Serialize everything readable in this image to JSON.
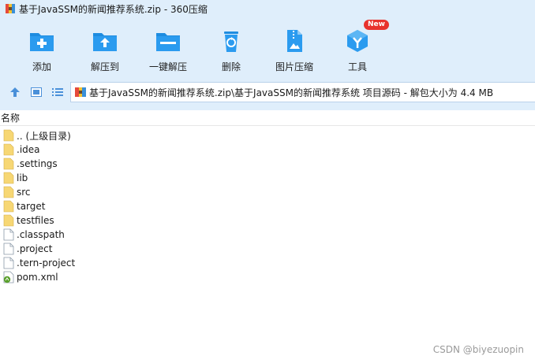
{
  "window": {
    "title": "基于JavaSSM的新闻推荐系统.zip - 360压缩"
  },
  "toolbar": {
    "add_label": "添加",
    "extract_to_label": "解压到",
    "one_click_extract_label": "一键解压",
    "delete_label": "删除",
    "image_compress_label": "图片压缩",
    "tools_label": "工具",
    "tools_badge": "New"
  },
  "address": {
    "path": "基于JavaSSM的新闻推荐系统.zip\\基于JavaSSM的新闻推荐系统 项目源码 - 解包大小为 4.4 MB"
  },
  "list": {
    "column_name": "名称",
    "items": [
      {
        "label": ".. (上级目录)",
        "type": "folder"
      },
      {
        "label": ".idea",
        "type": "folder"
      },
      {
        "label": ".settings",
        "type": "folder"
      },
      {
        "label": "lib",
        "type": "folder"
      },
      {
        "label": "src",
        "type": "folder"
      },
      {
        "label": "target",
        "type": "folder"
      },
      {
        "label": "testfiles",
        "type": "folder"
      },
      {
        "label": ".classpath",
        "type": "file"
      },
      {
        "label": ".project",
        "type": "file"
      },
      {
        "label": ".tern-project",
        "type": "file"
      },
      {
        "label": "pom.xml",
        "type": "xml"
      }
    ]
  },
  "watermark": "CSDN @biyezuopin",
  "colors": {
    "chrome_bg": "#dfeefb",
    "icon_blue": "#1e8ce0",
    "badge_red": "#e8322d",
    "folder_yellow": "#f7d774"
  }
}
